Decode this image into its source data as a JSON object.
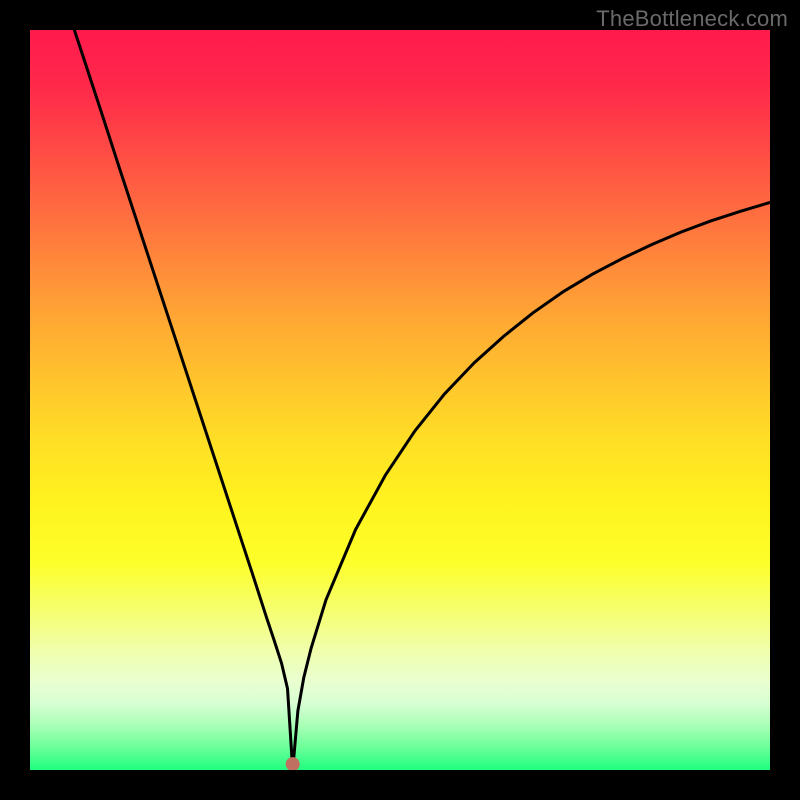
{
  "watermark": "TheBottleneck.com",
  "chart_data": {
    "type": "line",
    "title": "",
    "xlabel": "",
    "ylabel": "",
    "xlim": [
      0,
      100
    ],
    "ylim": [
      0,
      100
    ],
    "background_gradient": {
      "top": "#ff1a4d",
      "middle": "#ffe025",
      "bottom": "#1fff7f"
    },
    "marker": {
      "x": 35.5,
      "y": 0.8,
      "color": "#c07060",
      "radius_px": 7
    },
    "series": [
      {
        "name": "bottleneck-curve",
        "x": [
          6,
          8,
          10,
          12,
          14,
          16,
          18,
          20,
          22,
          24,
          26,
          28,
          30,
          32,
          33,
          34,
          34.8,
          35.5,
          36.2,
          37,
          38,
          40,
          44,
          48,
          52,
          56,
          60,
          64,
          68,
          72,
          76,
          80,
          84,
          88,
          92,
          96,
          100
        ],
        "y": [
          100,
          93.9,
          87.8,
          81.6,
          75.5,
          69.4,
          63.3,
          57.2,
          51.1,
          45.0,
          38.9,
          32.8,
          26.7,
          20.5,
          17.5,
          14.4,
          11.0,
          0.0,
          8.0,
          12.5,
          16.5,
          23.0,
          32.5,
          39.8,
          45.8,
          50.8,
          55.0,
          58.6,
          61.8,
          64.6,
          67.0,
          69.1,
          71.0,
          72.7,
          74.2,
          75.5,
          76.7
        ]
      }
    ]
  }
}
